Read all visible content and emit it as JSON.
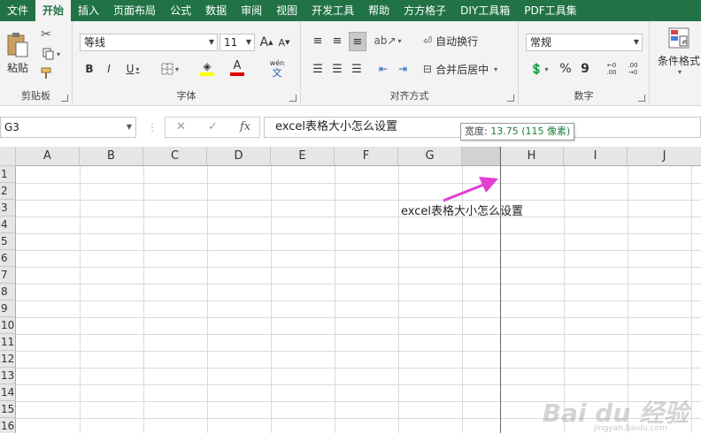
{
  "menu": {
    "tabs": [
      "文件",
      "开始",
      "插入",
      "页面布局",
      "公式",
      "数据",
      "审阅",
      "视图",
      "开发工具",
      "帮助",
      "方方格子",
      "DIY工具箱",
      "PDF工具集"
    ]
  },
  "ribbon": {
    "clipboard": {
      "label": "剪贴板",
      "paste": "粘贴"
    },
    "font": {
      "label": "字体",
      "name": "等线",
      "size": "11",
      "bold": "B",
      "italic": "I",
      "underline": "U",
      "font_color_letter": "A",
      "pinyin": "wén",
      "grow": "A",
      "shrink": "A"
    },
    "alignment": {
      "label": "对齐方式",
      "wrap": "自动换行",
      "merge": "合并后居中"
    },
    "number": {
      "label": "数字",
      "format": "常规",
      "percent": "%",
      "comma": "9",
      "inc_decimal": "←0 .00",
      "dec_decimal": ".00 →0"
    },
    "styles": {
      "conditional": "条件格式"
    }
  },
  "formula_bar": {
    "name_box": "G3",
    "fx": "fx",
    "cancel": "✕",
    "confirm": "✓",
    "content": "excel表格大小怎么设置"
  },
  "tooltip": {
    "prefix": "宽度: ",
    "value": "13.75 (115 像素)"
  },
  "columns": [
    "A",
    "B",
    "C",
    "D",
    "E",
    "F",
    "G",
    "",
    "H",
    "I",
    "J"
  ],
  "rows": [
    "1",
    "2",
    "3",
    "4",
    "5",
    "6",
    "7",
    "8",
    "9",
    "10",
    "11",
    "12",
    "13",
    "14",
    "15",
    "16"
  ],
  "cell_G3": "excel表格大小怎么设置",
  "colors": {
    "excel_green": "#217346",
    "arrow": "#e23ed3",
    "font_red": "#e00000",
    "highlight_yellow": "#ffff00"
  },
  "watermark": {
    "text": "Bai du 经验",
    "url": "jingyan.baidu.com"
  }
}
